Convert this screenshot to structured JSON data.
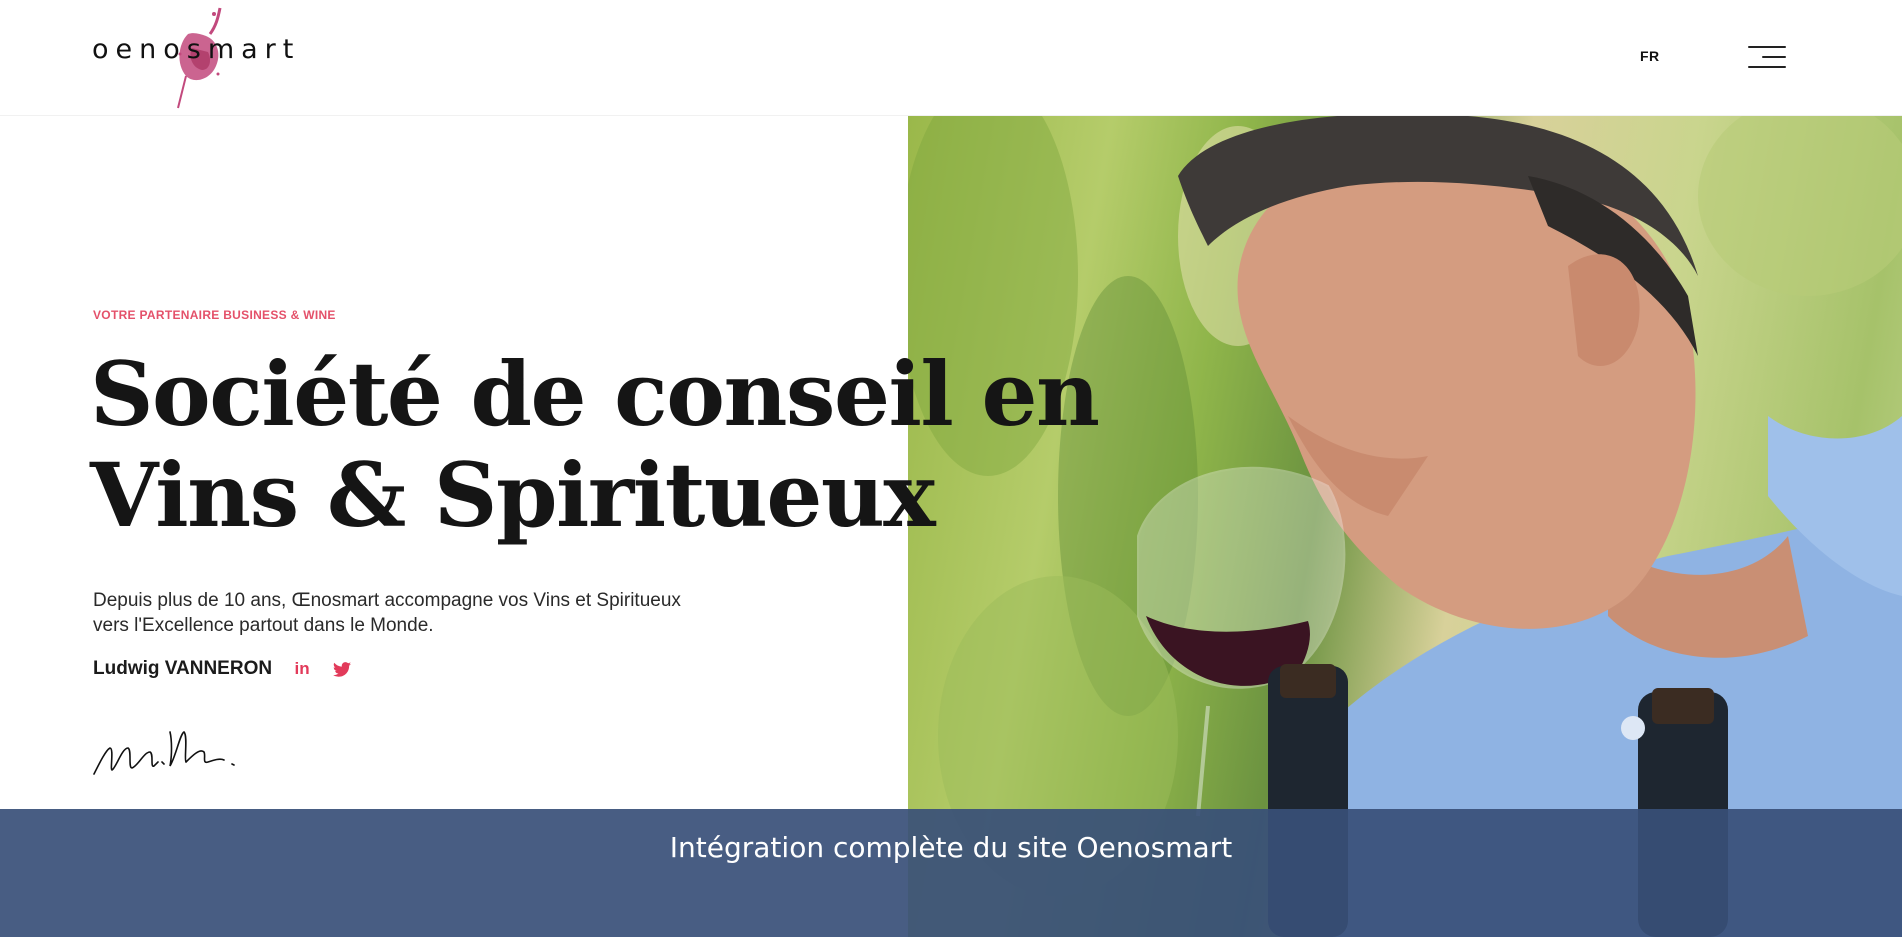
{
  "header": {
    "logo_text": "oenosmart",
    "language": "FR"
  },
  "hero": {
    "kicker": "VOTRE PARTENAIRE BUSINESS & WINE",
    "headline_line1": "Société de conseil en",
    "headline_line2": "Vins & Spiritueux",
    "lead_line1": "Depuis plus de 10 ans, Œnosmart accompagne vos Vins et Spiritueux",
    "lead_line2": "vers l'Excellence partout dans le Monde.",
    "author": "Ludwig VANNERON",
    "social": [
      {
        "icon": "linkedin-icon",
        "glyph": "in"
      },
      {
        "icon": "twitter-icon"
      }
    ]
  },
  "banner": {
    "caption": "Intégration complète du site Oenosmart"
  },
  "colors": {
    "accent": "#e4516a",
    "banner": "#384f78",
    "text": "#151515"
  }
}
